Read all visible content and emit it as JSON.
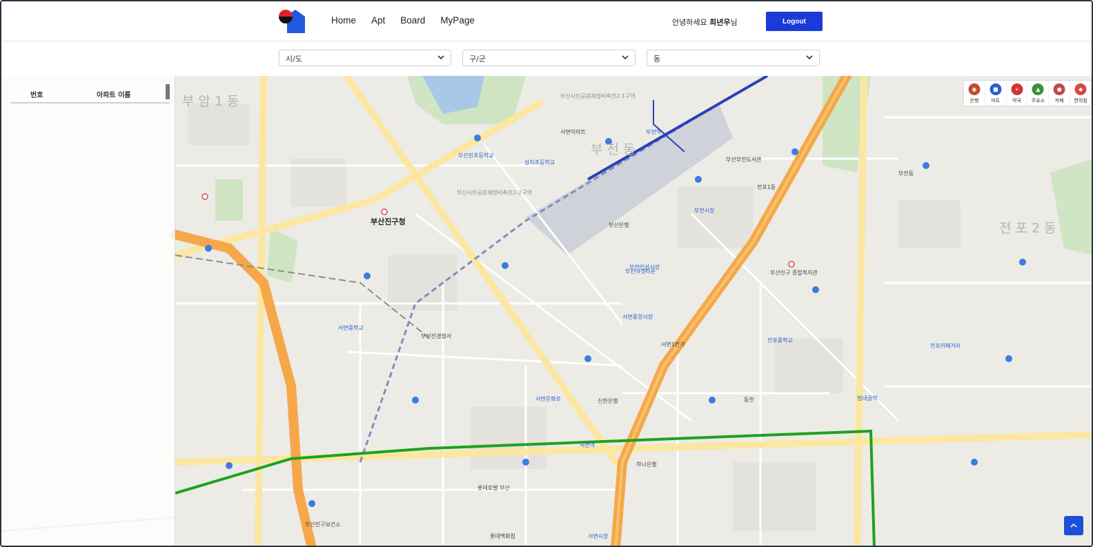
{
  "header": {
    "nav": [
      "Home",
      "Apt",
      "Board",
      "MyPage"
    ],
    "greeting_prefix": "안녕하세요",
    "user_name": "최년우",
    "greeting_suffix": "님",
    "logout_label": "Logout"
  },
  "filters": {
    "sido": "시/도",
    "gugun": "구/군",
    "dong": "동"
  },
  "side_panel": {
    "col_number": "번호",
    "col_apt_name": "아파트 이름"
  },
  "categories": [
    {
      "label": "은행",
      "icon": "bank-icon",
      "color": "#c0492e"
    },
    {
      "label": "마트",
      "icon": "cart-icon",
      "color": "#2a5fd4"
    },
    {
      "label": "약국",
      "icon": "pharmacy-icon",
      "color": "#d03535"
    },
    {
      "label": "주유소",
      "icon": "gas-station-icon",
      "color": "#3a8f3a"
    },
    {
      "label": "카페",
      "icon": "coffee-icon",
      "color": "#c44646"
    },
    {
      "label": "편의점",
      "icon": "store-icon",
      "color": "#d94444"
    }
  ],
  "map_labels": {
    "district_1": "부전동",
    "district_2": "전포2동",
    "district_3": "부암1동",
    "jinguchung": "부산진구청",
    "seomyeon": "서면역",
    "bujeon": "부전역",
    "bujeonmarket": "부전시장",
    "lotte": "롯데호텔 부산",
    "seomyeon_ms": "서면중학교",
    "jeonpo_ms": "전포중학교",
    "seongji_es": "성지초등학교",
    "bujeon_es": "부산진초등학교",
    "l1": "서면이마트",
    "l2": "부산부전도서관",
    "l3": "전포카페거리",
    "l4": "서면문화로",
    "l5": "신한은행",
    "l6": "부산은행",
    "l7": "하나은행",
    "l8": "롯데백화점",
    "l9": "부전마켓타운",
    "l10": "서면1번가",
    "l11": "부산진구 종합복지관",
    "l12": "전포1동",
    "l13": "동천",
    "l14": "부산시민공원재정비촉진2-1구역",
    "l15": "부산시민공원재정비촉진2-2구역",
    "l16": "부전동",
    "l17": "범내골역",
    "l18": "부산진구보건소",
    "l19": "서면중앙시장",
    "l20": "서면시장",
    "l21": "부전인삼시장",
    "l22": "부산진경찰서"
  },
  "scroll_top_icon": "arrow-up-icon"
}
